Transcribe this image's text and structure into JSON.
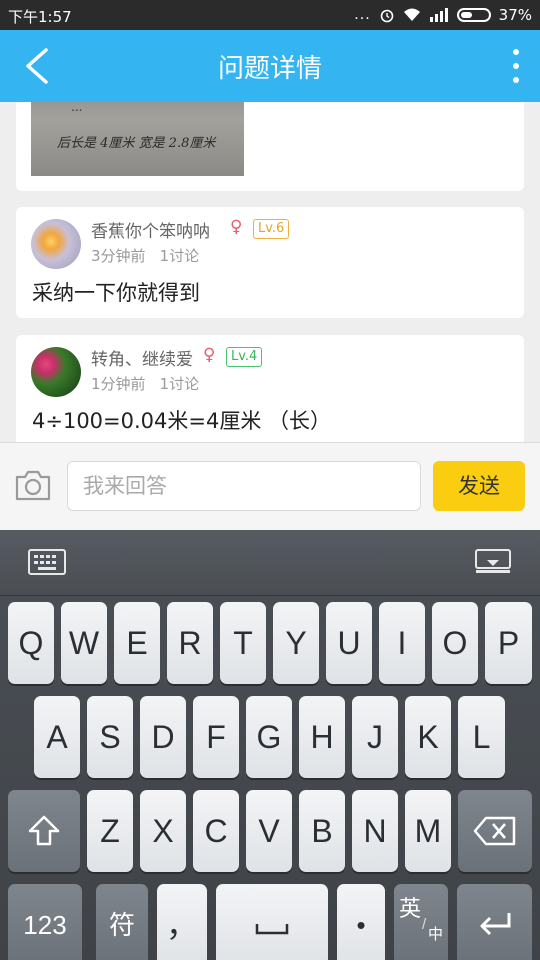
{
  "status_bar": {
    "time": "下午1:57",
    "dots": "...",
    "battery": "37%"
  },
  "app_bar": {
    "title": "问题详情"
  },
  "question": {
    "handwriting_line1": "后长是 4厘米 宽是 2.8厘米",
    "handwriting_line2": "..."
  },
  "answers": [
    {
      "user": "香蕉你个笨呐呐",
      "gender": "♀",
      "level": "Lv.6",
      "time": "3分钟前",
      "comments": "1讨论",
      "text": "采纳一下你就得到"
    },
    {
      "user": "转角、继续爱",
      "gender": "♀",
      "level": "Lv.4",
      "time": "1分钟前",
      "comments": "1讨论",
      "text": "4÷100=0.04米=4厘米 （长）"
    }
  ],
  "reply": {
    "placeholder": "我来回答",
    "send_label": "发送"
  },
  "keyboard": {
    "row1": [
      "Q",
      "W",
      "E",
      "R",
      "T",
      "Y",
      "U",
      "I",
      "O",
      "P"
    ],
    "row2": [
      "A",
      "S",
      "D",
      "F",
      "G",
      "H",
      "J",
      "K",
      "L"
    ],
    "row3": [
      "Z",
      "X",
      "C",
      "V",
      "B",
      "N",
      "M"
    ],
    "num_label": "123",
    "symbol_label": "符",
    "comma_label": "，",
    "period_label": "•",
    "lang_label": "英",
    "lang_sub_label": "中"
  }
}
